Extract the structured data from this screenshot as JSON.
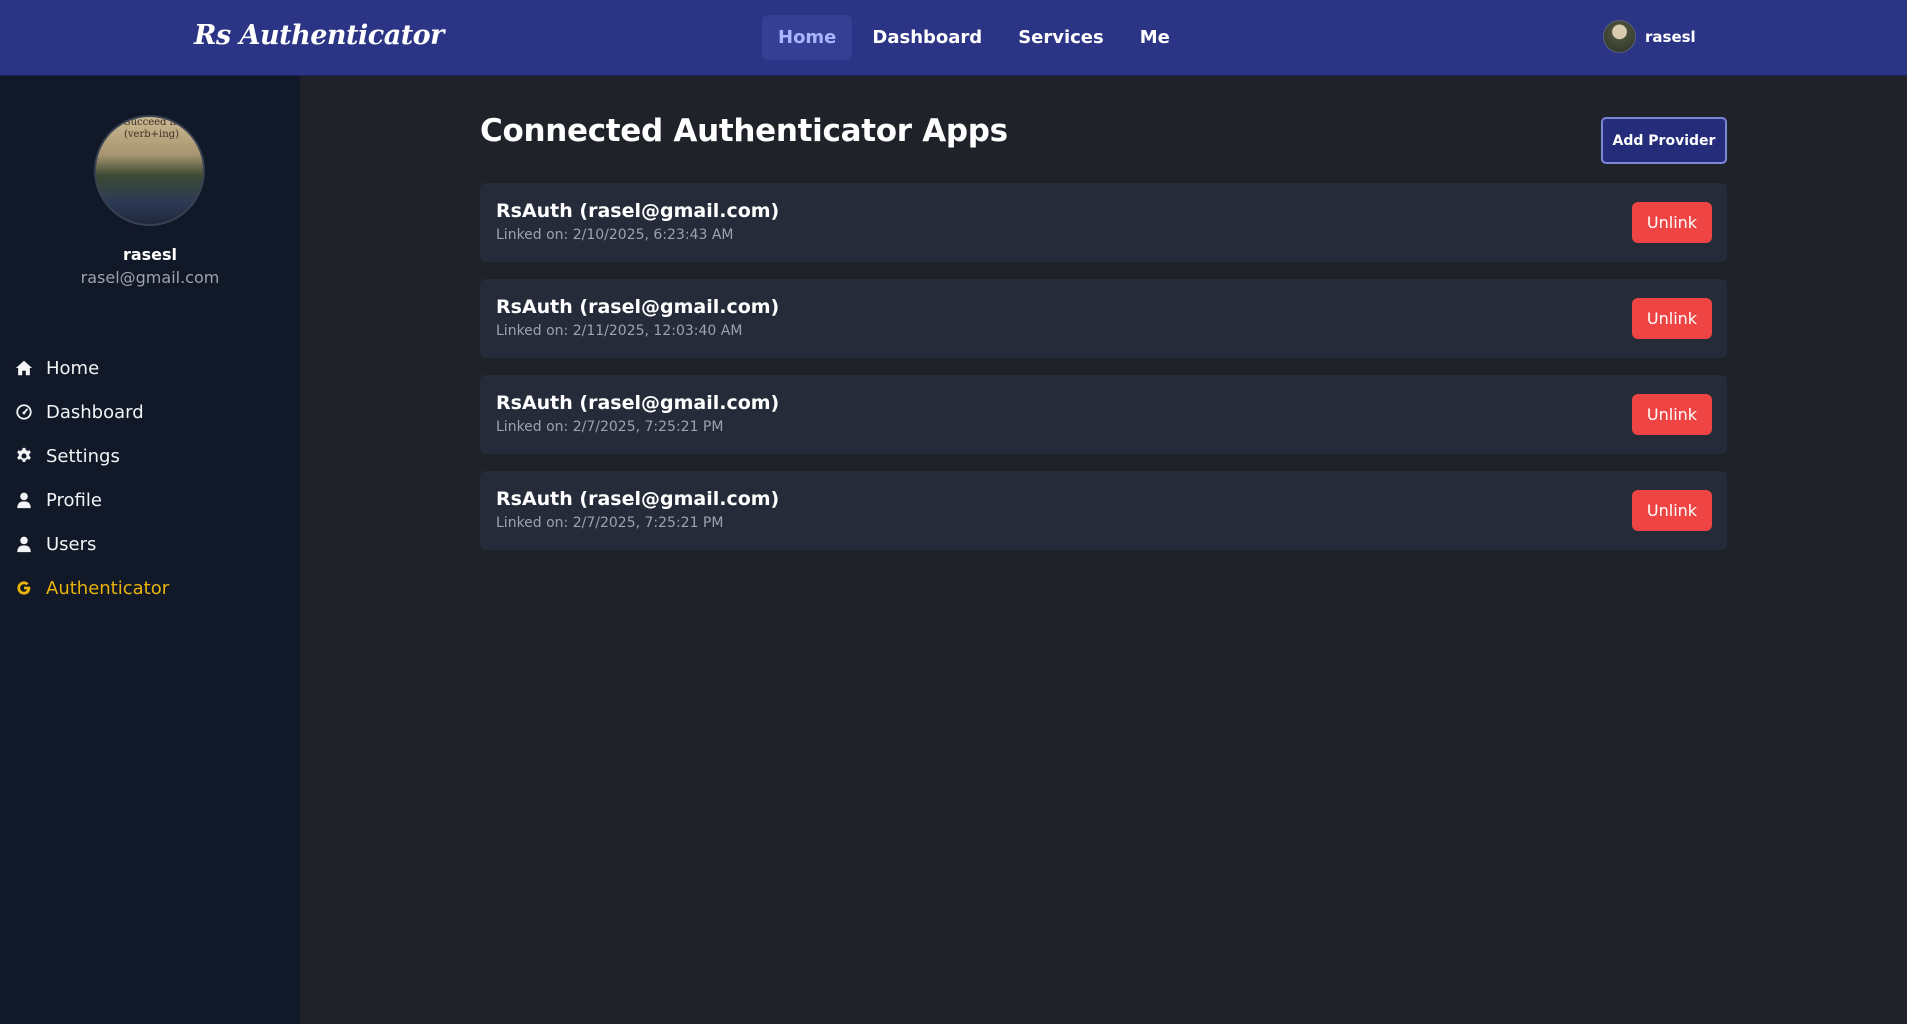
{
  "header": {
    "brand": "Rs Authenticator",
    "nav": [
      {
        "label": "Home",
        "active": true
      },
      {
        "label": "Dashboard"
      },
      {
        "label": "Services"
      },
      {
        "label": "Me"
      }
    ],
    "user_name": "rasesl"
  },
  "sidebar": {
    "profile": {
      "name": "rasesl",
      "email": "rasel@gmail.com",
      "avatar_shirt_text": "Succeed in (verb+ing)"
    },
    "items": [
      {
        "label": "Home",
        "icon": "home-icon"
      },
      {
        "label": "Dashboard",
        "icon": "gauge-icon"
      },
      {
        "label": "Settings",
        "icon": "gear-icon"
      },
      {
        "label": "Profile",
        "icon": "user-icon"
      },
      {
        "label": "Users",
        "icon": "users-icon"
      },
      {
        "label": "Authenticator",
        "icon": "google-icon",
        "active": true
      }
    ]
  },
  "main": {
    "title": "Connected Authenticator Apps",
    "add_label": "Add Provider",
    "apps": [
      {
        "name": "RsAuth (rasel@gmail.com)",
        "linked": "Linked on: 2/10/2025, 6:23:43 AM",
        "action": "Unlink"
      },
      {
        "name": "RsAuth (rasel@gmail.com)",
        "linked": "Linked on: 2/11/2025, 12:03:40 AM",
        "action": "Unlink"
      },
      {
        "name": "RsAuth (rasel@gmail.com)",
        "linked": "Linked on: 2/7/2025, 7:25:21 PM",
        "action": "Unlink"
      },
      {
        "name": "RsAuth (rasel@gmail.com)",
        "linked": "Linked on: 2/7/2025, 7:25:21 PM",
        "action": "Unlink"
      }
    ]
  },
  "colors": {
    "header_bg": "#2c3585",
    "sidebar_bg": "#111827",
    "main_bg": "#1f2329",
    "card_bg": "#252b38",
    "accent_active": "#eab308",
    "danger": "#ef4444",
    "nav_active_text": "#a9b6ff"
  }
}
